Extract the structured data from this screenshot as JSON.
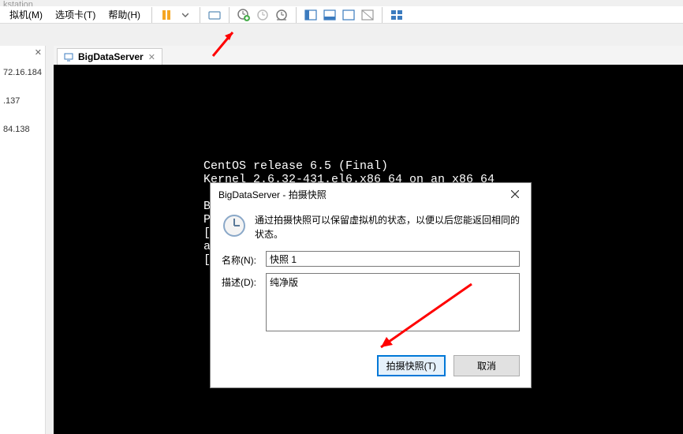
{
  "app_title_fragment": "kstation",
  "menubar": {
    "vm": "拟机(M)",
    "tabs": "选项卡(T)",
    "help": "帮助(H)"
  },
  "sidebar": {
    "ips": [
      "72.16.184.",
      ".137",
      "84.138"
    ]
  },
  "tab": {
    "label": "BigDataServer"
  },
  "terminal": {
    "line1": "CentOS release 6.5 (Final)",
    "line2": "Kernel 2.6.32-431.el6.x86_64 on an x86_64",
    "line3": "",
    "line4": "BigDa",
    "line5": "Passw",
    "line6": "[root",
    "line7": "anaco",
    "line8": "[root"
  },
  "dialog": {
    "title": "BigDataServer - 拍摄快照",
    "info": "通过拍摄快照可以保留虚拟机的状态，以便以后您能返回相同的状态。",
    "name_label": "名称(N):",
    "name_value": "快照 1",
    "desc_label": "描述(D):",
    "desc_value": "纯净版",
    "ok": "拍摄快照(T)",
    "cancel": "取消"
  }
}
